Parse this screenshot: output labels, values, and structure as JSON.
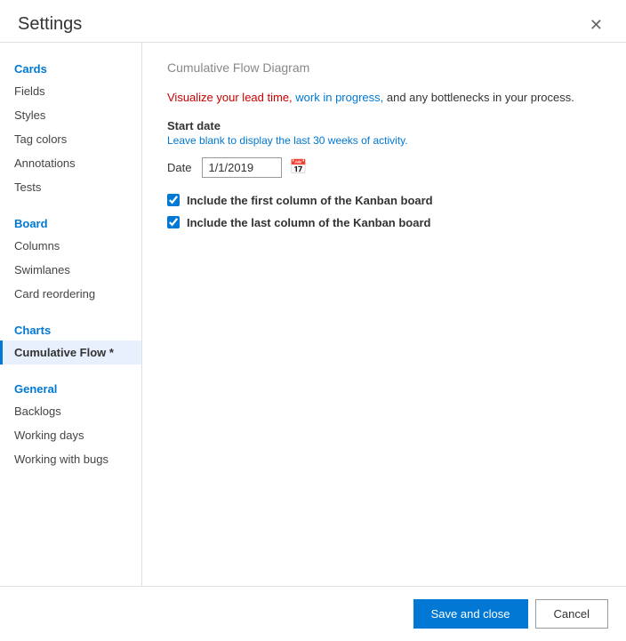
{
  "dialog": {
    "title": "Settings",
    "close_icon": "✕"
  },
  "sidebar": {
    "cards_section": "Cards",
    "cards_items": [
      {
        "label": "Fields",
        "active": false
      },
      {
        "label": "Styles",
        "active": false
      },
      {
        "label": "Tag colors",
        "active": false
      },
      {
        "label": "Annotations",
        "active": false
      },
      {
        "label": "Tests",
        "active": false
      }
    ],
    "board_section": "Board",
    "board_items": [
      {
        "label": "Columns",
        "active": false
      },
      {
        "label": "Swimlanes",
        "active": false
      },
      {
        "label": "Card reordering",
        "active": false
      }
    ],
    "charts_section": "Charts",
    "charts_items": [
      {
        "label": "Cumulative Flow *",
        "active": true
      }
    ],
    "general_section": "General",
    "general_items": [
      {
        "label": "Backlogs",
        "active": false
      },
      {
        "label": "Working days",
        "active": false
      },
      {
        "label": "Working with bugs",
        "active": false
      }
    ]
  },
  "main": {
    "section_heading": "Cumulative Flow Diagram",
    "description_part1": "Visualize your lead time, work in progress, and any bottlenecks in your process.",
    "start_date_label": "Start date",
    "start_date_hint": "Leave blank to display the last 30 weeks of activity.",
    "date_label": "Date",
    "date_value": "1/1/2019",
    "calendar_icon": "📅",
    "checkbox1_label": "Include the first column of the Kanban board",
    "checkbox2_label": "Include the last column of the Kanban board"
  },
  "footer": {
    "save_label": "Save and close",
    "cancel_label": "Cancel"
  }
}
